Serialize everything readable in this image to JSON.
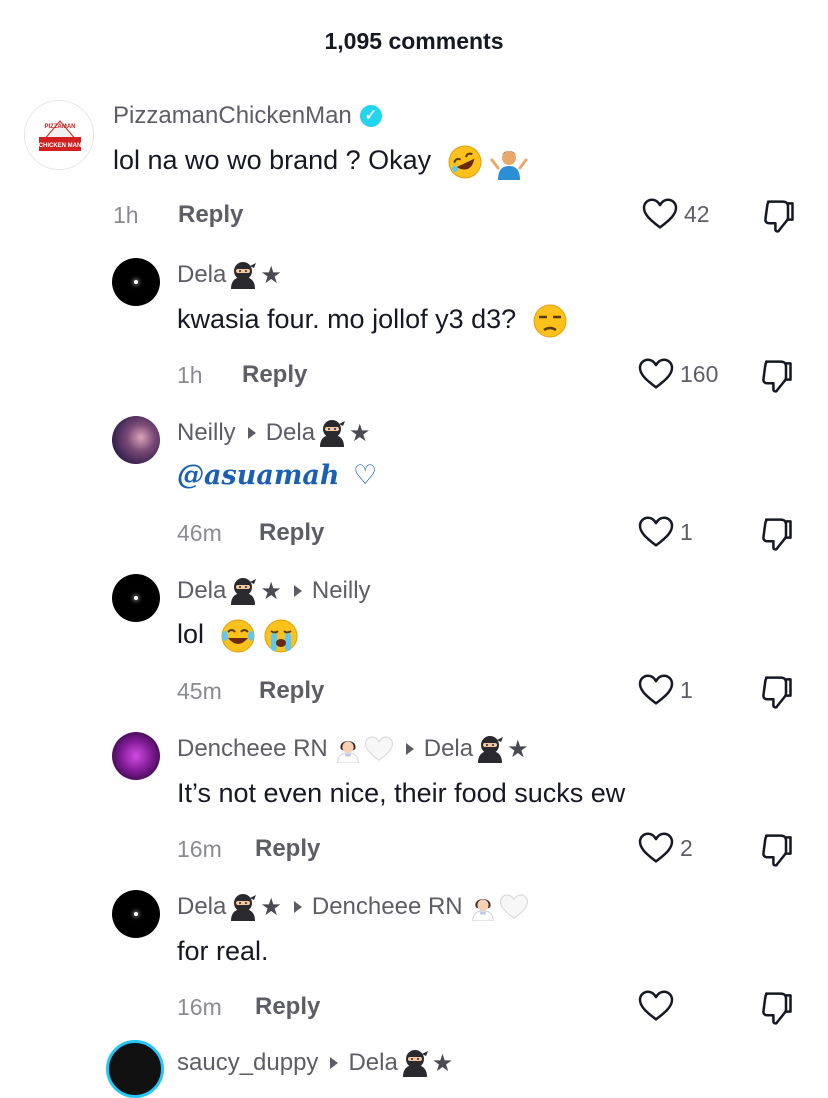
{
  "header": {
    "title": "1,095 comments"
  },
  "colors": {
    "verified": "#20d5ec",
    "mention": "#1a5fb4",
    "story_ring": "#25c6f5"
  },
  "reply_label": "Reply",
  "comments": [
    {
      "author": "PizzamanChickenMan",
      "verified": true,
      "text": "lol na wo wo brand ? Okay",
      "emojis": [
        "rolling-laughing-emoji",
        "man-shrugging-emoji"
      ],
      "time": "1h",
      "likes": "42",
      "avatar_logo_top": "PIZZAMAN",
      "avatar_logo_bottom": "CHICKEN MAN"
    },
    {
      "author": "Dela",
      "suffix": "★",
      "text": "kwasia four. mo jollof y3 d3?",
      "emojis": [
        "unamused-face-emoji"
      ],
      "time": "1h",
      "likes": "160"
    },
    {
      "author": "Neilly",
      "reply_to": "Dela",
      "reply_to_suffix": "★",
      "mention": "@asuamah",
      "text_after": "♡",
      "time": "46m",
      "likes": "1"
    },
    {
      "author": "Dela",
      "suffix": "★",
      "reply_to": "Neilly",
      "text": "lol",
      "emojis": [
        "tears-of-joy-emoji",
        "loudly-crying-emoji"
      ],
      "time": "45m",
      "likes": "1"
    },
    {
      "author": "Dencheee RN",
      "reply_to": "Dela",
      "reply_to_suffix": "★",
      "text": "It’s not even nice, their food sucks ew",
      "time": "16m",
      "likes": "2"
    },
    {
      "author": "Dela",
      "suffix": "★",
      "reply_to": "Dencheee RN",
      "text": "for real.",
      "time": "16m",
      "likes": ""
    },
    {
      "author": "saucy_duppy",
      "reply_to": "Dela",
      "reply_to_suffix": "★"
    }
  ]
}
